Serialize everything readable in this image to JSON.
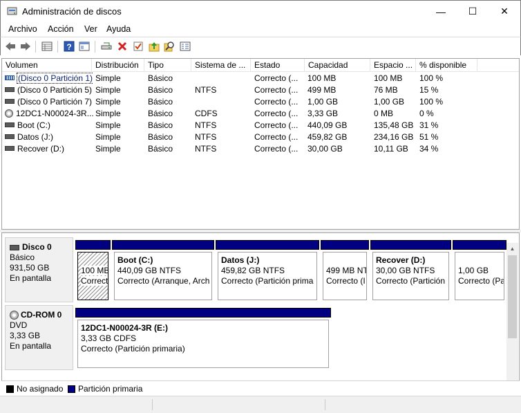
{
  "window": {
    "title": "Administración de discos",
    "min_glyph": "—",
    "max_glyph": "☐",
    "close_glyph": "✕"
  },
  "menu": [
    "Archivo",
    "Acción",
    "Ver",
    "Ayuda"
  ],
  "toolbar": {
    "icons": [
      "back-arrow-icon",
      "forward-arrow-icon",
      "properties-grid-icon",
      "help-icon",
      "show-hide-pane-icon",
      "connect-drive-icon",
      "delete-icon",
      "check-icon",
      "folder-up-icon",
      "search-icon",
      "rescan-icon"
    ]
  },
  "volume_list": {
    "headers": [
      "Volumen",
      "Distribución",
      "Tipo",
      "Sistema de ...",
      "Estado",
      "Capacidad",
      "Espacio ...",
      "% disponible"
    ],
    "rows": [
      {
        "icon": "volume-blue",
        "volume": "(Disco 0 Partición 1)",
        "layout": "Simple",
        "type": "Básico",
        "fs": "",
        "status": "Correcto (...",
        "capacity": "100 MB",
        "free": "100 MB",
        "pct": "100 %"
      },
      {
        "icon": "volume",
        "volume": "(Disco 0 Partición 5)",
        "layout": "Simple",
        "type": "Básico",
        "fs": "NTFS",
        "status": "Correcto (...",
        "capacity": "499 MB",
        "free": "76 MB",
        "pct": "15 %"
      },
      {
        "icon": "volume",
        "volume": "(Disco 0 Partición 7)",
        "layout": "Simple",
        "type": "Básico",
        "fs": "",
        "status": "Correcto (...",
        "capacity": "1,00 GB",
        "free": "1,00 GB",
        "pct": "100 %"
      },
      {
        "icon": "cd",
        "volume": "12DC1-N00024-3R...",
        "layout": "Simple",
        "type": "Básico",
        "fs": "CDFS",
        "status": "Correcto (...",
        "capacity": "3,33 GB",
        "free": "0 MB",
        "pct": "0 %"
      },
      {
        "icon": "volume",
        "volume": "Boot (C:)",
        "layout": "Simple",
        "type": "Básico",
        "fs": "NTFS",
        "status": "Correcto (...",
        "capacity": "440,09 GB",
        "free": "135,48 GB",
        "pct": "31 %"
      },
      {
        "icon": "volume",
        "volume": "Datos (J:)",
        "layout": "Simple",
        "type": "Básico",
        "fs": "NTFS",
        "status": "Correcto (...",
        "capacity": "459,82 GB",
        "free": "234,16 GB",
        "pct": "51 %"
      },
      {
        "icon": "volume",
        "volume": "Recover (D:)",
        "layout": "Simple",
        "type": "Básico",
        "fs": "NTFS",
        "status": "Correcto (...",
        "capacity": "30,00 GB",
        "free": "10,11 GB",
        "pct": "34 %"
      }
    ]
  },
  "disks": [
    {
      "name": "Disco 0",
      "kind": "Básico",
      "size": "931,50 GB",
      "state": "En pantalla",
      "partitions": [
        {
          "title": "",
          "size": "100 MB",
          "status": "Correcto",
          "selected": true
        },
        {
          "title": "Boot  (C:)",
          "size": "440,09 GB NTFS",
          "status": "Correcto (Arranque, Arch"
        },
        {
          "title": "Datos  (J:)",
          "size": "459,82 GB NTFS",
          "status": "Correcto (Partición prima"
        },
        {
          "title": "",
          "size": "499 MB NT",
          "status": "Correcto (I"
        },
        {
          "title": "Recover  (D:)",
          "size": "30,00 GB NTFS",
          "status": "Correcto (Partición"
        },
        {
          "title": "",
          "size": "1,00 GB",
          "status": "Correcto (Pa"
        }
      ]
    },
    {
      "name": "CD-ROM 0",
      "kind": "DVD",
      "size": "3,33 GB",
      "state": "En pantalla",
      "partitions": [
        {
          "title": "12DC1-N00024-3R  (E:)",
          "size": "3,33 GB CDFS",
          "status": "Correcto (Partición primaria)"
        }
      ]
    }
  ],
  "legend": [
    {
      "label": "No asignado",
      "color": "#000000"
    },
    {
      "label": "Partición primaria",
      "color": "#000080"
    }
  ],
  "colors": {
    "primary_partition": "#000080",
    "unallocated": "#000000",
    "selection_outline": "#000000"
  }
}
